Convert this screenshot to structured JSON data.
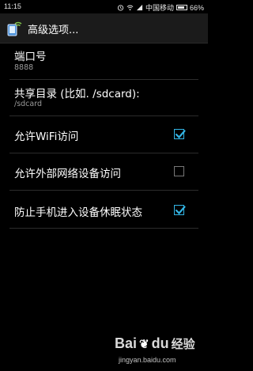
{
  "status_bar": {
    "time": "11:15",
    "carrier": "中国移动",
    "battery": "66%",
    "battery_level": 0.66
  },
  "action_bar": {
    "title": "高级选项..."
  },
  "settings": [
    {
      "title": "端口号",
      "summary": "8888"
    },
    {
      "title": "共享目录 (比如. /sdcard):",
      "summary": "/sdcard"
    },
    {
      "title": "允许WiFi访问",
      "checked": true
    },
    {
      "title": "允许外部网络设备访问",
      "checked": false
    },
    {
      "title": "防止手机进入设备休眠状态",
      "checked": true
    }
  ],
  "watermark": {
    "logo_text": "Bai",
    "logo_text2": "经验",
    "logo_text_du": "du",
    "url": "jingyan.baidu.com"
  },
  "colors": {
    "accent": "#33b5e5",
    "background": "#000000",
    "action_bar": "#1b1b1b",
    "summary_text": "#9a9a9a"
  }
}
